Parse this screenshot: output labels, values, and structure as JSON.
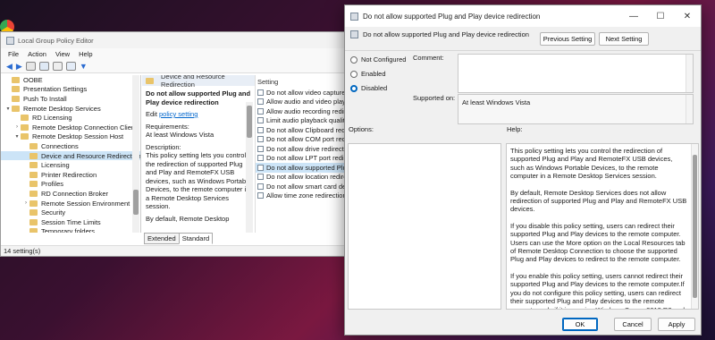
{
  "gpe": {
    "title": "Local Group Policy Editor",
    "menu": [
      "File",
      "Action",
      "View",
      "Help"
    ],
    "tree": [
      {
        "label": "OOBE",
        "indent": 1,
        "arrow": ""
      },
      {
        "label": "Presentation Settings",
        "indent": 1,
        "arrow": ""
      },
      {
        "label": "Push To Install",
        "indent": 1,
        "arrow": ""
      },
      {
        "label": "Remote Desktop Services",
        "indent": 1,
        "arrow": "▾"
      },
      {
        "label": "RD Licensing",
        "indent": 2,
        "arrow": ""
      },
      {
        "label": "Remote Desktop Connection Client",
        "indent": 2,
        "arrow": "›"
      },
      {
        "label": "Remote Desktop Session Host",
        "indent": 2,
        "arrow": "▾"
      },
      {
        "label": "Connections",
        "indent": 3,
        "arrow": ""
      },
      {
        "label": "Device and Resource Redirection",
        "indent": 3,
        "arrow": "",
        "selected": true
      },
      {
        "label": "Licensing",
        "indent": 3,
        "arrow": ""
      },
      {
        "label": "Printer Redirection",
        "indent": 3,
        "arrow": ""
      },
      {
        "label": "Profiles",
        "indent": 3,
        "arrow": ""
      },
      {
        "label": "RD Connection Broker",
        "indent": 3,
        "arrow": ""
      },
      {
        "label": "Remote Session Environment",
        "indent": 3,
        "arrow": "›"
      },
      {
        "label": "Security",
        "indent": 3,
        "arrow": ""
      },
      {
        "label": "Session Time Limits",
        "indent": 3,
        "arrow": ""
      },
      {
        "label": "Temporary folders",
        "indent": 3,
        "arrow": ""
      }
    ],
    "mid_header": "Device and Resource Redirection",
    "mid_title": "Do not allow supported Plug and Play device redirection",
    "edit_prefix": "Edit ",
    "edit_link": "policy setting",
    "requirements_label": "Requirements:",
    "requirements_value": "At least Windows Vista",
    "description_label": "Description:",
    "description_text": "This policy setting lets you control the redirection of supported Plug and Play and RemoteFX USB devices, such as Windows Portable Devices, to the remote computer in a Remote Desktop Services session.",
    "description_more": "By default, Remote Desktop",
    "setting_header": "Setting",
    "settings": [
      "Do not allow video capture redi",
      "Allow audio and video playba",
      "Allow audio recording redirect",
      "Limit audio playback quality",
      "Do not allow Clipboard redirec",
      "Do not allow COM port redirec",
      "Do not allow drive redirection",
      "Do not allow LPT port redirecti",
      "Do not allow supported Plug a",
      "Do not allow location redirecti",
      "Do not allow smart card device",
      "Allow time zone redirection"
    ],
    "tabs": [
      "Extended",
      "Standard"
    ],
    "status": "14 setting(s)"
  },
  "dialog": {
    "title": "Do not allow supported Plug and Play device redirection",
    "header_title": "Do not allow supported Plug and Play device redirection",
    "prev_button": "Previous Setting",
    "next_button": "Next Setting",
    "radios": [
      {
        "label": "Not Configured",
        "checked": false
      },
      {
        "label": "Enabled",
        "checked": false
      },
      {
        "label": "Disabled",
        "checked": true
      }
    ],
    "comment_label": "Comment:",
    "supported_label": "Supported on:",
    "supported_value": "At least Windows Vista",
    "options_label": "Options:",
    "help_label": "Help:",
    "help_paragraphs": [
      "This policy setting lets you control the redirection of supported Plug and Play and RemoteFX USB devices, such as Windows Portable Devices, to the remote computer in a Remote Desktop Services session.",
      "By default, Remote Desktop Services does not allow redirection of supported Plug and Play and RemoteFX USB devices.",
      "If you disable this policy setting, users can redirect their supported Plug and Play devices to the remote computer. Users can use the More option on the Local Resources tab of Remote Desktop Connection to choose the supported Plug and Play devices to redirect to the remote computer.",
      "If you enable this policy setting, users cannot redirect their supported Plug and Play devices to the remote computer.If you do not configure this policy setting, users can redirect their supported Plug and Play devices to the remote computer only if it is running Windows Server 2012 R2 and earlier versions."
    ],
    "ok": "OK",
    "cancel": "Cancel",
    "apply": "Apply"
  },
  "colors": {
    "accent": "#0067c0",
    "selection": "#cce4f7",
    "link": "#0066cc"
  }
}
